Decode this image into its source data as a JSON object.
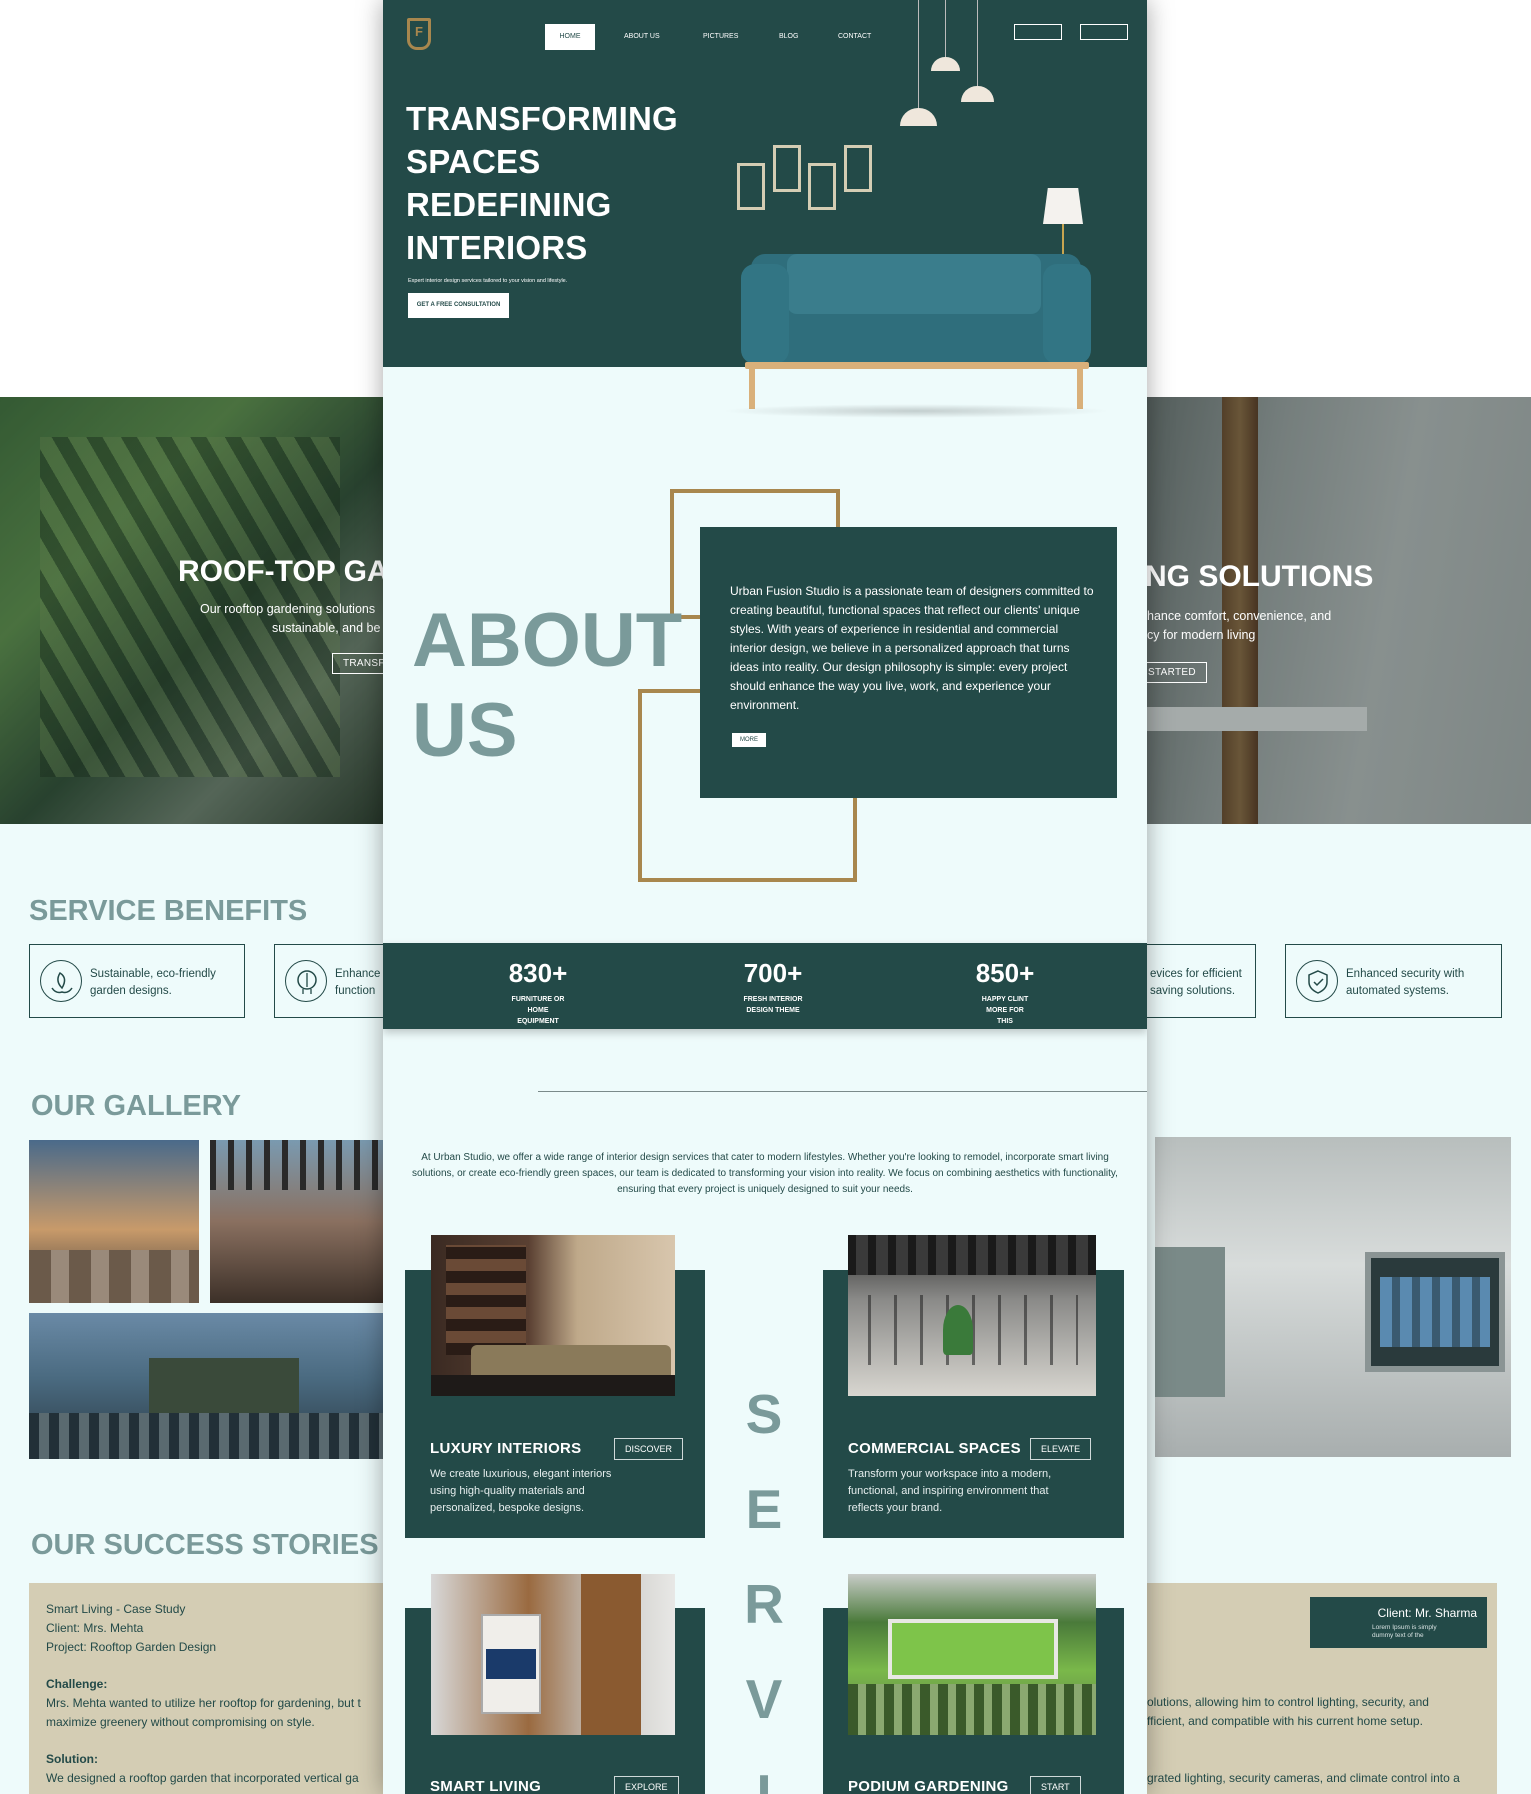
{
  "nav": {
    "logo": "F",
    "items": [
      "HOME",
      "ABOUT US",
      "PICTURES",
      "BLOG",
      "CONTACT"
    ],
    "active": "HOME"
  },
  "hero": {
    "title_lines": [
      "TRANSFORMING",
      "SPACES",
      "REDEFINING",
      "INTERIORS"
    ],
    "subtitle": "Expert interior design services tailored to your vision and lifestyle.",
    "cta": "GET A FREE CONSULTATION"
  },
  "about": {
    "heading_lines": [
      "ABOUT",
      "US"
    ],
    "body": "Urban Fusion Studio is a passionate team of designers committed to creating beautiful, functional spaces that reflect our clients' unique styles. With years of experience in residential and commercial interior design, we believe in a personalized approach that turns ideas into reality. Our design philosophy is simple: every project should enhance the way you live, work, and experience your environment.",
    "more": "MORE"
  },
  "stats": [
    {
      "num": "830+",
      "label": "FURNITURE OR HOME EQUIPMENT"
    },
    {
      "num": "700+",
      "label": "FRESH INTERIOR DESIGN THEME"
    },
    {
      "num": "850+",
      "label": "HAPPY CLINT MORE FOR THIS"
    }
  ],
  "services": {
    "intro": "At Urban Studio, we offer a wide range of interior design services that cater to modern lifestyles. Whether you're looking to remodel, incorporate smart living solutions, or create eco-friendly green spaces, our team is dedicated to transforming your vision into reality. We focus on combining aesthetics with functionality, ensuring that every project is uniquely designed to suit your needs.",
    "vertical_letters": [
      "S",
      "E",
      "R",
      "V",
      "I"
    ],
    "cards": [
      {
        "title": "LUXURY INTERIORS",
        "button": "DISCOVER",
        "desc": "We create luxurious, elegant interiors using high-quality materials and personalized, bespoke designs."
      },
      {
        "title": "COMMERCIAL SPACES",
        "button": "ELEVATE",
        "desc": "Transform your workspace into a modern, functional, and inspiring environment that reflects your brand."
      },
      {
        "title": "SMART LIVING",
        "button": "EXPLORE",
        "desc": ""
      },
      {
        "title": "PODIUM GARDENING",
        "button": "START",
        "desc": ""
      }
    ]
  },
  "left_page": {
    "hero_title": "ROOF-TOP GA",
    "hero_text_lines": [
      "Our rooftop gardening solutions",
      "sustainable, and be"
    ],
    "hero_button": "TRANSFO",
    "benefits_heading": "SERVICE BENEFITS",
    "benefits": [
      "Sustainable, eco-friendly garden designs.",
      "Enhance function"
    ],
    "gallery_heading": "OUR GALLERY",
    "stories_heading": "OUR SUCCESS STORIES",
    "story": {
      "title": "Smart Living - Case Study",
      "client": "Client: Mrs. Mehta",
      "project": "Project: Rooftop Garden Design",
      "challenge_label": "Challenge:",
      "challenge_lines": [
        "Mrs. Mehta wanted to utilize her rooftop for gardening, but t",
        "maximize greenery without compromising on style."
      ],
      "solution_label": "Solution:",
      "solution_text": "We designed a rooftop garden that incorporated vertical ga"
    }
  },
  "right_page": {
    "hero_title": "NG SOLUTIONS",
    "hero_text_lines": [
      "hance comfort, convenience, and",
      "cy for modern living"
    ],
    "hero_button": "STARTED",
    "benefits": [
      "evices for efficient saving solutions.",
      "Enhanced security with automated systems."
    ],
    "client_name": "Client: Mr. Sharma",
    "client_note": "Lorem Ipsum is simply dummy text of the",
    "story_lines": [
      "olutions, allowing him to control lighting, security, and",
      "fficient, and compatible with his current home setup.",
      "grated lighting, security cameras, and climate control into a"
    ]
  },
  "colors": {
    "teal": "#234a48",
    "mint": "#eefbfb",
    "gold": "#a8874e",
    "muted": "#7a9a9a",
    "sand": "#d4cdb4"
  }
}
